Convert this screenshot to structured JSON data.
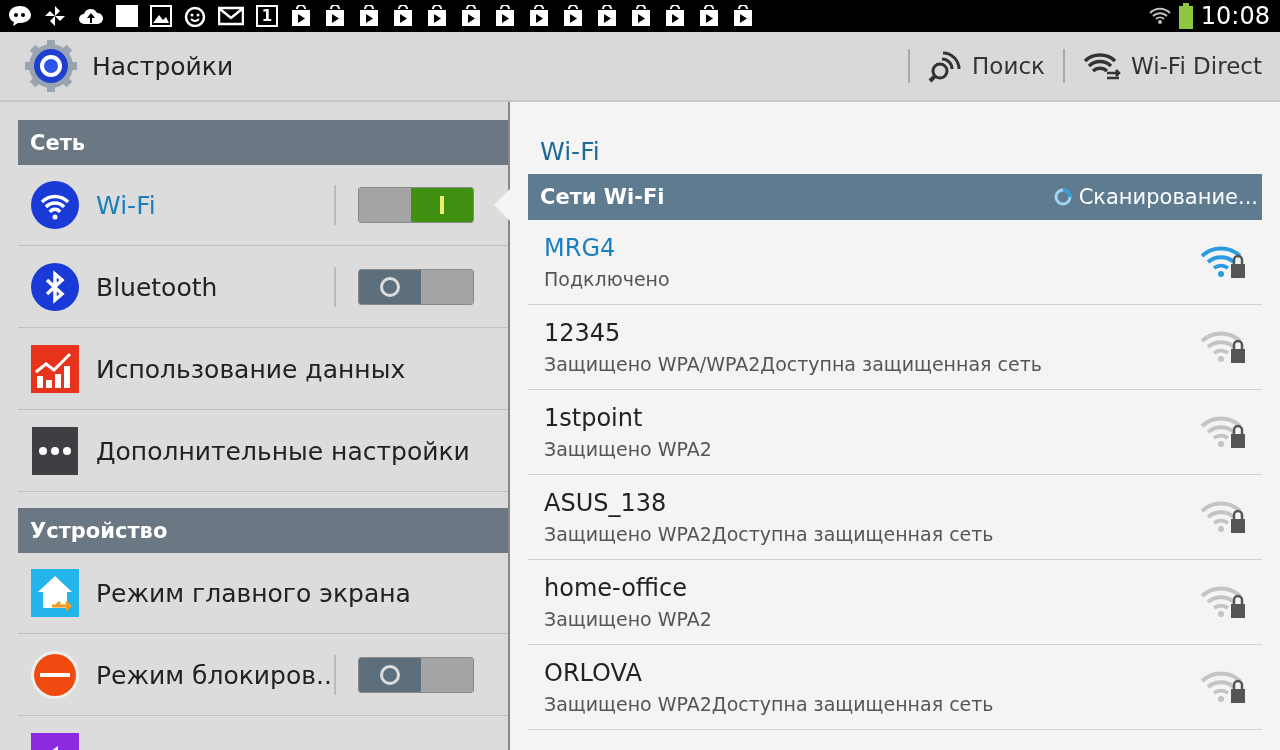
{
  "status_bar": {
    "calendar_day": "1",
    "time": "10:08"
  },
  "action_bar": {
    "title": "Настройки",
    "actions": [
      {
        "kind": "search",
        "label": "Поиск"
      },
      {
        "kind": "wifi-direct",
        "label": "Wi-Fi Direct"
      }
    ]
  },
  "sidebar": {
    "sections": [
      {
        "title": "Сеть",
        "items": [
          {
            "kind": "wifi",
            "label": "Wi-Fi",
            "selected": true,
            "on": true
          },
          {
            "kind": "bluetooth",
            "label": "Bluetooth",
            "selected": false,
            "on": false
          },
          {
            "kind": "data",
            "label": "Использование данных",
            "selected": false
          },
          {
            "kind": "more",
            "label": "Дополнительные настройки",
            "selected": false
          }
        ]
      },
      {
        "title": "Устройство",
        "items": [
          {
            "kind": "home",
            "label": "Режим главного экрана",
            "selected": false
          },
          {
            "kind": "block",
            "label": "Режим блокиров..",
            "selected": false,
            "on": false
          },
          {
            "kind": "sound",
            "selected": false
          }
        ]
      }
    ]
  },
  "detail": {
    "title": "Wi-Fi",
    "list_header": "Сети Wi-Fi",
    "scan_status": "Сканирование...",
    "networks": [
      {
        "name": "MRG4",
        "status": "Подключено",
        "connected": true
      },
      {
        "name": "12345",
        "status": "Защищено WPA/WPA2Доступна защищенная сеть",
        "connected": false
      },
      {
        "name": "1stpoint",
        "status": "Защищено WPA2",
        "connected": false
      },
      {
        "name": "ASUS_138",
        "status": "Защищено WPA2Доступна защищенная сеть",
        "connected": false
      },
      {
        "name": "home-office",
        "status": "Защищено WPA2",
        "connected": false
      },
      {
        "name": "ORLOVA",
        "status": "Защищено WPA2Доступна защищенная сеть",
        "connected": false
      }
    ]
  }
}
